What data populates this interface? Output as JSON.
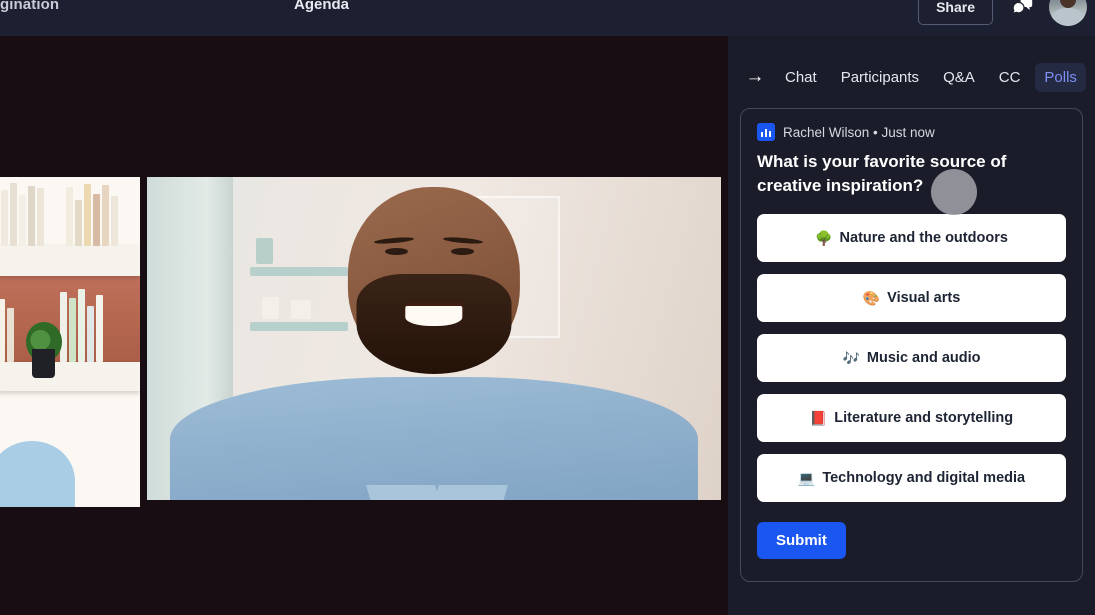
{
  "topbar": {
    "title_truncated": "gination",
    "center_label": "Agenda",
    "share_label": "Share",
    "reactions_icon": "reactions-icon",
    "avatar_label": "avatar"
  },
  "panel": {
    "collapse_icon": "arrow-right-icon",
    "tabs": [
      {
        "label": "Chat",
        "active": false
      },
      {
        "label": "Participants",
        "active": false
      },
      {
        "label": "Q&A",
        "active": false
      },
      {
        "label": "CC",
        "active": false
      },
      {
        "label": "Polls",
        "active": true
      }
    ],
    "poll": {
      "badge_icon": "poll-bar-chart-icon",
      "author": "Rachel Wilson",
      "separator": "•",
      "timestamp": "Just now",
      "meta_line": "Rachel Wilson • Just now",
      "question": "What is your favorite source of creative inspiration?",
      "options": [
        {
          "emoji": "🌳",
          "label": "Nature and the outdoors",
          "icon": "tree-icon"
        },
        {
          "emoji": "🎨",
          "label": "Visual arts",
          "icon": "palette-icon"
        },
        {
          "emoji": "🎶",
          "label": "Music and audio",
          "icon": "music-notes-icon"
        },
        {
          "emoji": "📕",
          "label": "Literature and storytelling",
          "icon": "book-icon"
        },
        {
          "emoji": "💻",
          "label": "Technology and digital media",
          "icon": "laptop-icon"
        }
      ],
      "submit_label": "Submit"
    }
  },
  "stage": {
    "tiles": [
      {
        "name": "participant-tile-left",
        "description": "bookshelf background"
      },
      {
        "name": "participant-tile-main",
        "description": "smiling man in denim shirt"
      }
    ]
  },
  "colors": {
    "topbar_bg": "#1c2030",
    "stage_bg": "#190d14",
    "panel_bg": "#1a1d29",
    "card_border": "#434959",
    "accent_blue": "#1a56f0",
    "tab_active_text": "#7d8ef5",
    "tab_active_bg": "#242a42",
    "option_bg": "#ffffff",
    "option_text": "#1d2433"
  }
}
